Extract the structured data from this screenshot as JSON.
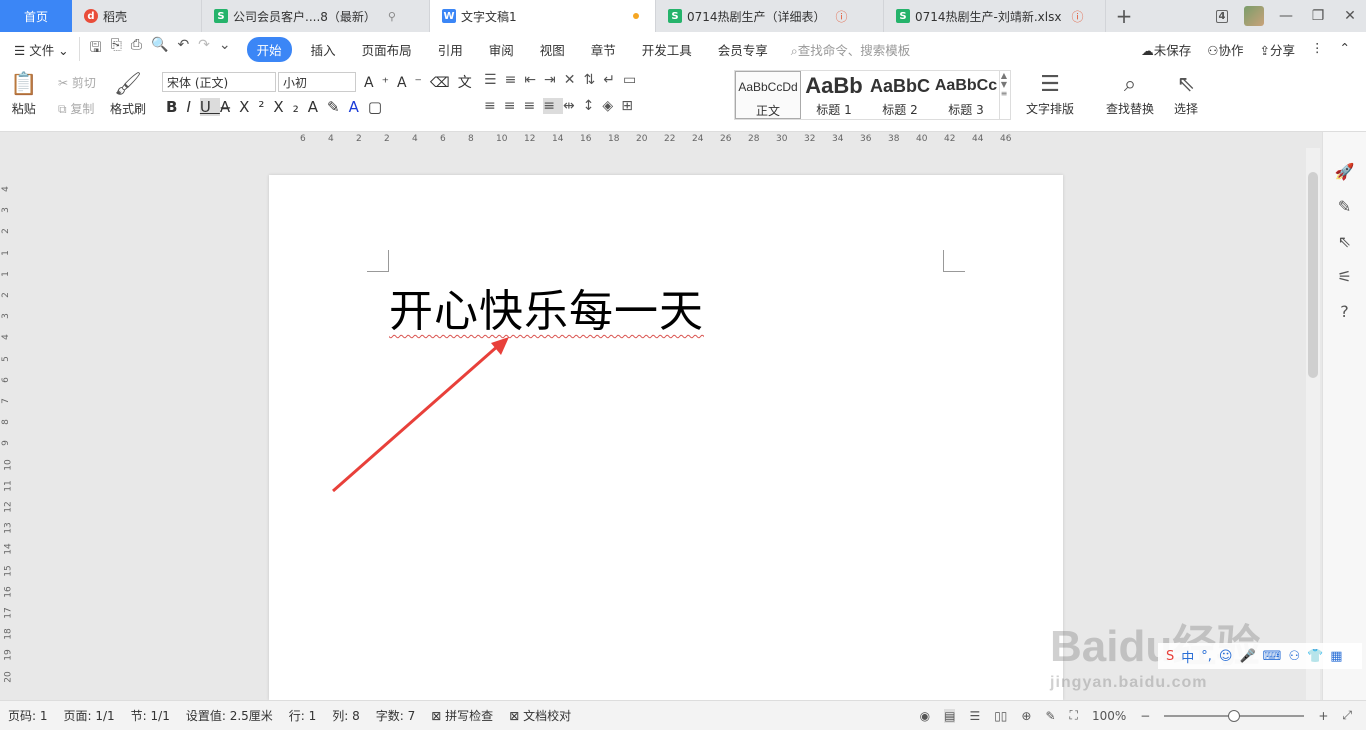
{
  "tabs": {
    "home": "首页",
    "items": [
      {
        "label": "稻壳",
        "icon": "daoke-icon"
      },
      {
        "label": "公司会员客户....8（最新）",
        "icon": "sheet-icon"
      },
      {
        "label": "文字文稿1",
        "icon": "writer-icon"
      },
      {
        "label": "0714热剧生产（详细表）",
        "icon": "sheet-icon"
      },
      {
        "label": "0714热剧生产-刘靖新.xlsx",
        "icon": "sheet-icon"
      }
    ],
    "window_count": "4",
    "ic_s": "S",
    "ic_w": "W",
    "ic_d": "d"
  },
  "menu": {
    "file": "文件",
    "items": [
      "开始",
      "插入",
      "页面布局",
      "引用",
      "审阅",
      "视图",
      "章节",
      "开发工具",
      "会员专享"
    ],
    "search": "查找命令、搜索模板",
    "unsaved": "未保存",
    "collab": "协作",
    "share": "分享"
  },
  "ribbon": {
    "paste": "粘贴",
    "cut": "剪切",
    "copy": "复制",
    "format_painter": "格式刷",
    "font_name": "宋体 (正文)",
    "font_size": "小初",
    "styles": [
      {
        "preview": "AaBbCcDd",
        "name": "正文"
      },
      {
        "preview": "AaBb",
        "name": "标题 1"
      },
      {
        "preview": "AaBbC",
        "name": "标题 2"
      },
      {
        "preview": "AaBbCc",
        "name": "标题 3"
      }
    ],
    "text_layout": "文字排版",
    "find_replace": "查找替换",
    "select": "选择"
  },
  "document": {
    "text": "开心快乐每一天"
  },
  "ruler": {
    "h": [
      "6",
      "4",
      "2",
      "2",
      "4",
      "6",
      "8",
      "10",
      "12",
      "14",
      "16",
      "18",
      "20",
      "22",
      "24",
      "26",
      "28",
      "30",
      "32",
      "34",
      "36",
      "38",
      "40",
      "42",
      "44",
      "46"
    ],
    "v": [
      "4",
      "3",
      "2",
      "1",
      "1",
      "2",
      "3",
      "4",
      "5",
      "6",
      "7",
      "8",
      "9",
      "10",
      "11",
      "12",
      "13",
      "14",
      "15",
      "16",
      "17",
      "18",
      "19",
      "20"
    ]
  },
  "status": {
    "page_num": "页码: 1",
    "pages": "页面: 1/1",
    "section": "节: 1/1",
    "setting": "设置值: 2.5厘米",
    "row": "行: 1",
    "col": "列: 8",
    "words": "字数: 7",
    "spell": "拼写检查",
    "proof": "文档校对",
    "zoom": "100%"
  },
  "watermark": {
    "brand": "Baidu经验",
    "url": "jingyan.baidu.com"
  },
  "colors": {
    "accent": "#3b86f6",
    "arrow": "#e8403a"
  }
}
